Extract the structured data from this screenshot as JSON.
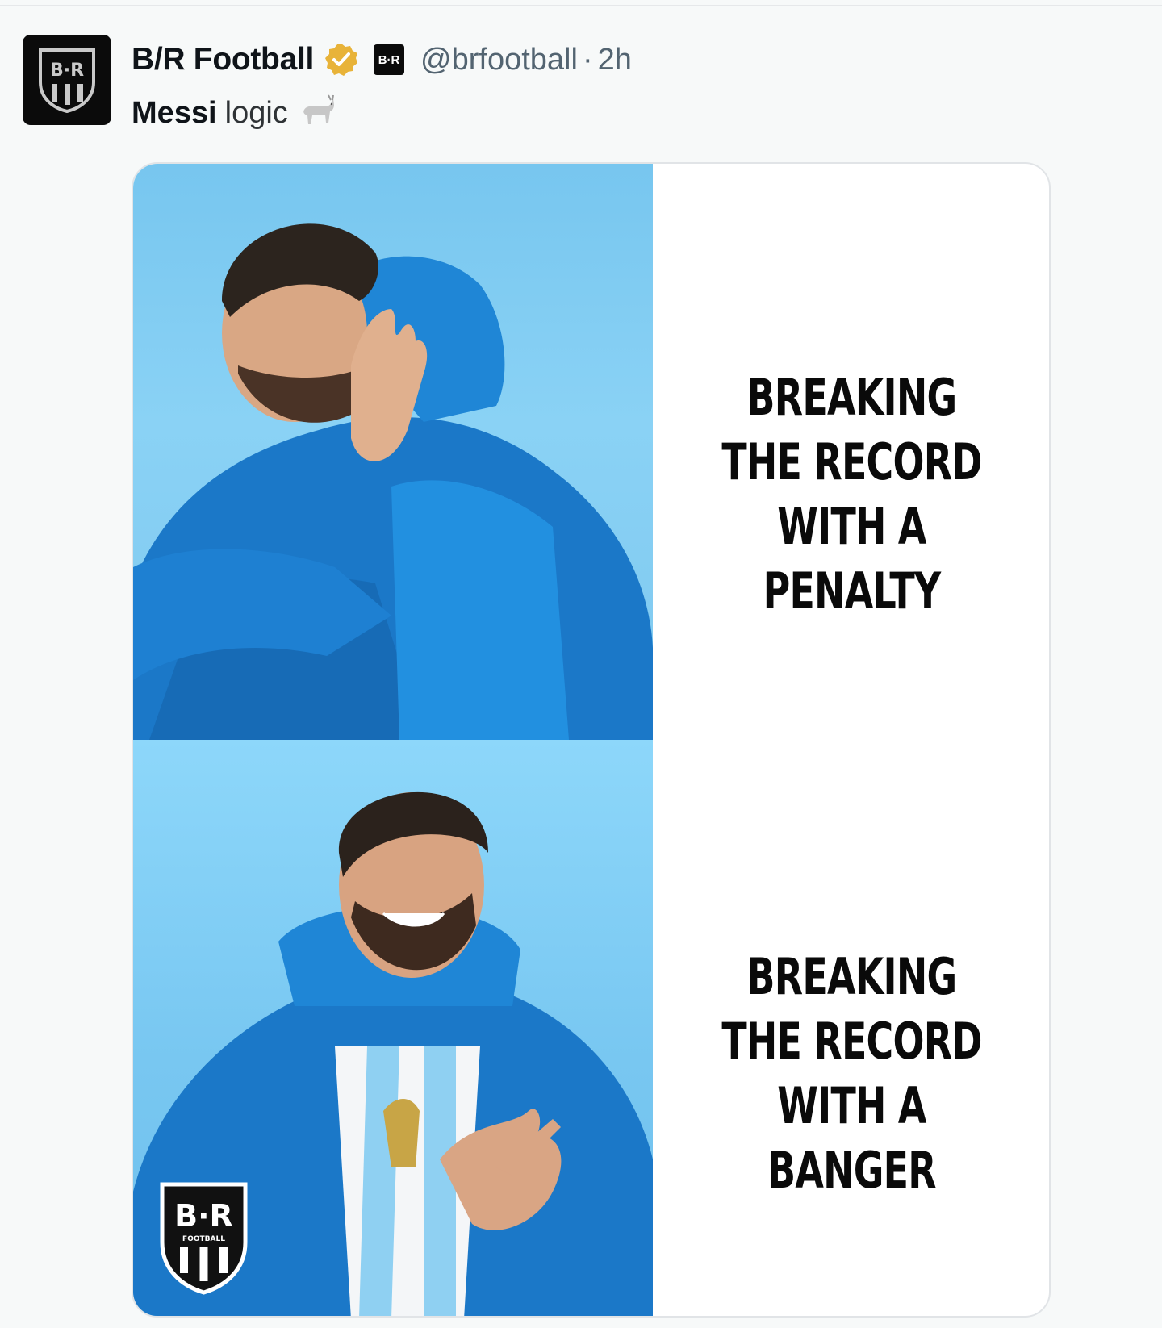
{
  "tweet": {
    "author": {
      "name": "B/R Football",
      "handle": "@brfootball",
      "separator": "·",
      "time": "2h",
      "avatar_text": "B·R",
      "affiliate_badge_text": "B·R",
      "verified_color": "#e8b339"
    },
    "text_bold": "Messi",
    "text_rest": "logic",
    "emoji_icon": "goat-icon",
    "media": {
      "caption_top": "BREAKING THE RECORD WITH A PENALTY",
      "caption_bottom": "BREAKING THE RECORD WITH A BANGER",
      "watermark_text": "B·R",
      "watermark_subtext": "FOOTBALL",
      "panel_bg_color": "#7ec8ef"
    }
  }
}
